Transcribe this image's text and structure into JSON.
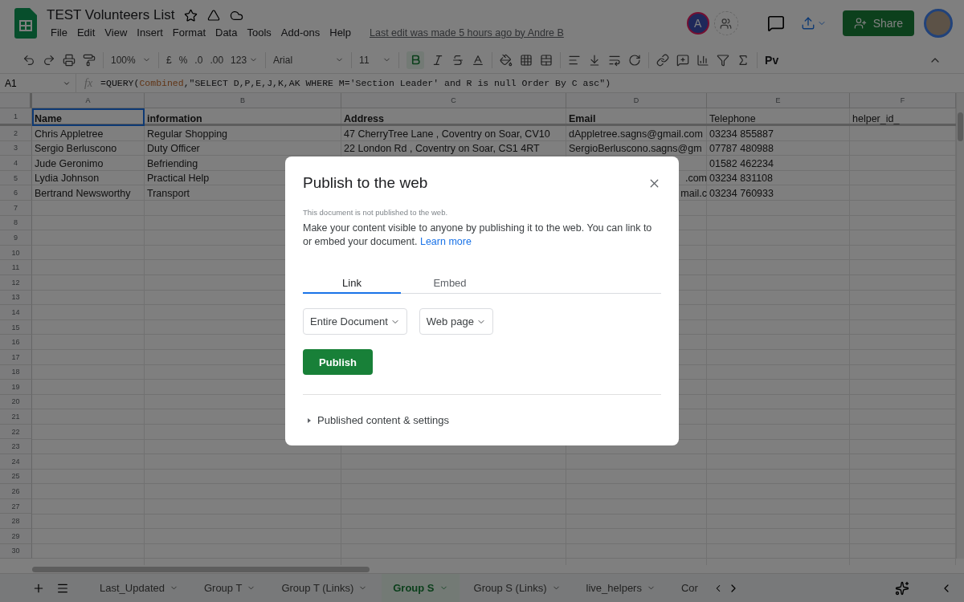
{
  "header": {
    "doc_title": "TEST Volunteers List",
    "menu": [
      "File",
      "Edit",
      "View",
      "Insert",
      "Format",
      "Data",
      "Tools",
      "Add-ons",
      "Help"
    ],
    "last_edit": "Last edit was made 5 hours ago by Andre B",
    "avatar_letter": "A",
    "share_label": "Share"
  },
  "toolbar": {
    "zoom": "100%",
    "currency": "£",
    "percent": "%",
    "decimal_decrease": ".0",
    "decimal_increase": ".00",
    "number_format": "123",
    "font": "Arial",
    "font_size": "11",
    "bold_active": true,
    "script_label": "Pv"
  },
  "formula_bar": {
    "cell_ref": "A1",
    "fx": "fx",
    "formula": [
      {
        "kind": "plain",
        "text": "=QUERY("
      },
      {
        "kind": "range",
        "text": "Combined"
      },
      {
        "kind": "plain",
        "text": ",\"SELECT D,P,E,J,K,AK WHERE M='Section Leader' and R is null Order By C asc\")"
      }
    ]
  },
  "grid": {
    "columns": [
      "A",
      "B",
      "C",
      "D",
      "E",
      "F"
    ],
    "rows": [
      {
        "number": "1",
        "cells": [
          {
            "text": "Name",
            "bold": true,
            "selected": true
          },
          {
            "text": "information",
            "bold": true,
            "selected": false
          },
          {
            "text": "Address",
            "bold": true,
            "selected": false
          },
          {
            "text": "Email",
            "bold": true,
            "selected": false
          },
          {
            "text": "Telephone",
            "bold": false,
            "selected": false
          },
          {
            "text": "helper_id_",
            "bold": false,
            "selected": false
          }
        ]
      },
      {
        "number": "2",
        "cells": [
          "Chris Appletree",
          "Regular Shopping",
          "47 CherryTree Lane , Coventry on Soar, CV10",
          "dAppletree.sagns@gmail.com",
          "03234 855887",
          null
        ]
      },
      {
        "number": "3",
        "cells": [
          "Sergio Berluscono",
          "Duty Officer",
          "22 London Rd , Coventry on Soar, CS1 4RT",
          "SergioBerluscono.sagns@gm",
          "07787 480988",
          null
        ]
      },
      {
        "number": "4",
        "cells": [
          "Jude Geronimo",
          "Befriending",
          null,
          null,
          "01582 462234",
          null
        ]
      },
      {
        "number": "5",
        "cells": [
          "Lydia Johnson",
          "Practical Help",
          null,
          {
            "text": ".com",
            "covered": true
          },
          "03234 831108",
          null
        ]
      },
      {
        "number": "6",
        "cells": [
          "Bertrand Newsworthy",
          "Transport",
          null,
          {
            "text": "mail.c",
            "covered": true
          },
          "03234 760933",
          null
        ]
      },
      {
        "number": "7"
      },
      {
        "number": "8"
      },
      {
        "number": "9"
      },
      {
        "number": "10"
      },
      {
        "number": "11"
      },
      {
        "number": "12"
      },
      {
        "number": "13"
      },
      {
        "number": "14"
      },
      {
        "number": "15"
      },
      {
        "number": "16"
      },
      {
        "number": "17"
      },
      {
        "number": "18"
      },
      {
        "number": "19"
      },
      {
        "number": "20"
      },
      {
        "number": "21"
      },
      {
        "number": "22"
      },
      {
        "number": "23"
      },
      {
        "number": "24"
      },
      {
        "number": "25"
      },
      {
        "number": "26"
      },
      {
        "number": "27"
      },
      {
        "number": "28"
      },
      {
        "number": "29"
      },
      {
        "number": "30"
      }
    ]
  },
  "sheet_tabs": [
    {
      "label": "Last_Updated",
      "selected": false,
      "has_menu": true
    },
    {
      "label": "Group T",
      "selected": false,
      "has_menu": true
    },
    {
      "label": "Group T (Links)",
      "selected": false,
      "has_menu": true
    },
    {
      "label": "Group S",
      "selected": true,
      "has_menu": true
    },
    {
      "label": "Group S (Links)",
      "selected": false,
      "has_menu": true
    },
    {
      "label": "live_helpers",
      "selected": false,
      "has_menu": true
    },
    {
      "label": "Cor",
      "selected": false,
      "has_menu": false
    }
  ],
  "dialog": {
    "title": "Publish to the web",
    "status": "This document is not published to the web.",
    "description": "Make your content visible to anyone by publishing it to the web. You can link to or embed your document.",
    "learn_more": "Learn more",
    "tabs": [
      {
        "label": "Link",
        "selected": true
      },
      {
        "label": "Embed",
        "selected": false
      }
    ],
    "dropdowns": [
      "Entire Document",
      "Web page"
    ],
    "publish_label": "Publish",
    "settings_label": "Published content & settings",
    "settings_expanded": false
  }
}
